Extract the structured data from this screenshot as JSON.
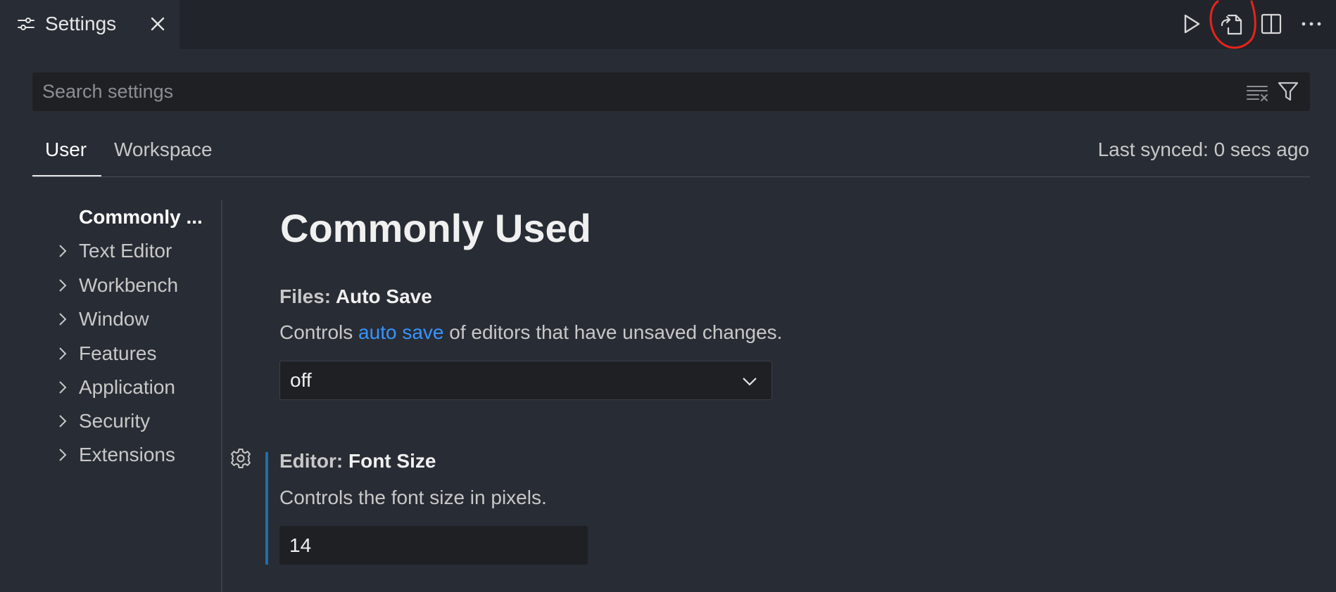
{
  "tab": {
    "title": "Settings",
    "icon": "settings-sliders-icon",
    "close_icon": "close-icon"
  },
  "toolbar": {
    "icons": [
      "run-icon",
      "open-settings-json-icon",
      "split-editor-icon",
      "more-actions-icon"
    ],
    "annotation": "red hand-drawn circle around open-settings-json-icon"
  },
  "search": {
    "placeholder": "Search settings",
    "value": "",
    "clear_icon": "clear-search-icon",
    "filter_icon": "filter-icon"
  },
  "scope": {
    "tabs": [
      {
        "label": "User",
        "active": true
      },
      {
        "label": "Workspace",
        "active": false
      }
    ],
    "sync_status": "Last synced: 0 secs ago"
  },
  "toc": {
    "items": [
      {
        "label": "Commonly ...",
        "active": true,
        "expandable": false
      },
      {
        "label": "Text Editor",
        "active": false,
        "expandable": true
      },
      {
        "label": "Workbench",
        "active": false,
        "expandable": true
      },
      {
        "label": "Window",
        "active": false,
        "expandable": true
      },
      {
        "label": "Features",
        "active": false,
        "expandable": true
      },
      {
        "label": "Application",
        "active": false,
        "expandable": true
      },
      {
        "label": "Security",
        "active": false,
        "expandable": true
      },
      {
        "label": "Extensions",
        "active": false,
        "expandable": true
      }
    ]
  },
  "main": {
    "section_title": "Commonly Used",
    "settings": [
      {
        "category": "Files: ",
        "name": "Auto Save",
        "description_before": "Controls ",
        "description_link": "auto save",
        "description_after": " of editors that have unsaved changes.",
        "control": "select",
        "value": "off"
      },
      {
        "category": "Editor: ",
        "name": "Font Size",
        "description": "Controls the font size in pixels.",
        "control": "number",
        "value": "14",
        "modified_indicator": true
      }
    ]
  },
  "colors": {
    "background": "#282c34",
    "tabbar_background": "#21252b",
    "input_background": "#1e2024",
    "link": "#3794ff",
    "modified_bar": "#1f6fa8",
    "annotation_red": "#e8231b"
  }
}
